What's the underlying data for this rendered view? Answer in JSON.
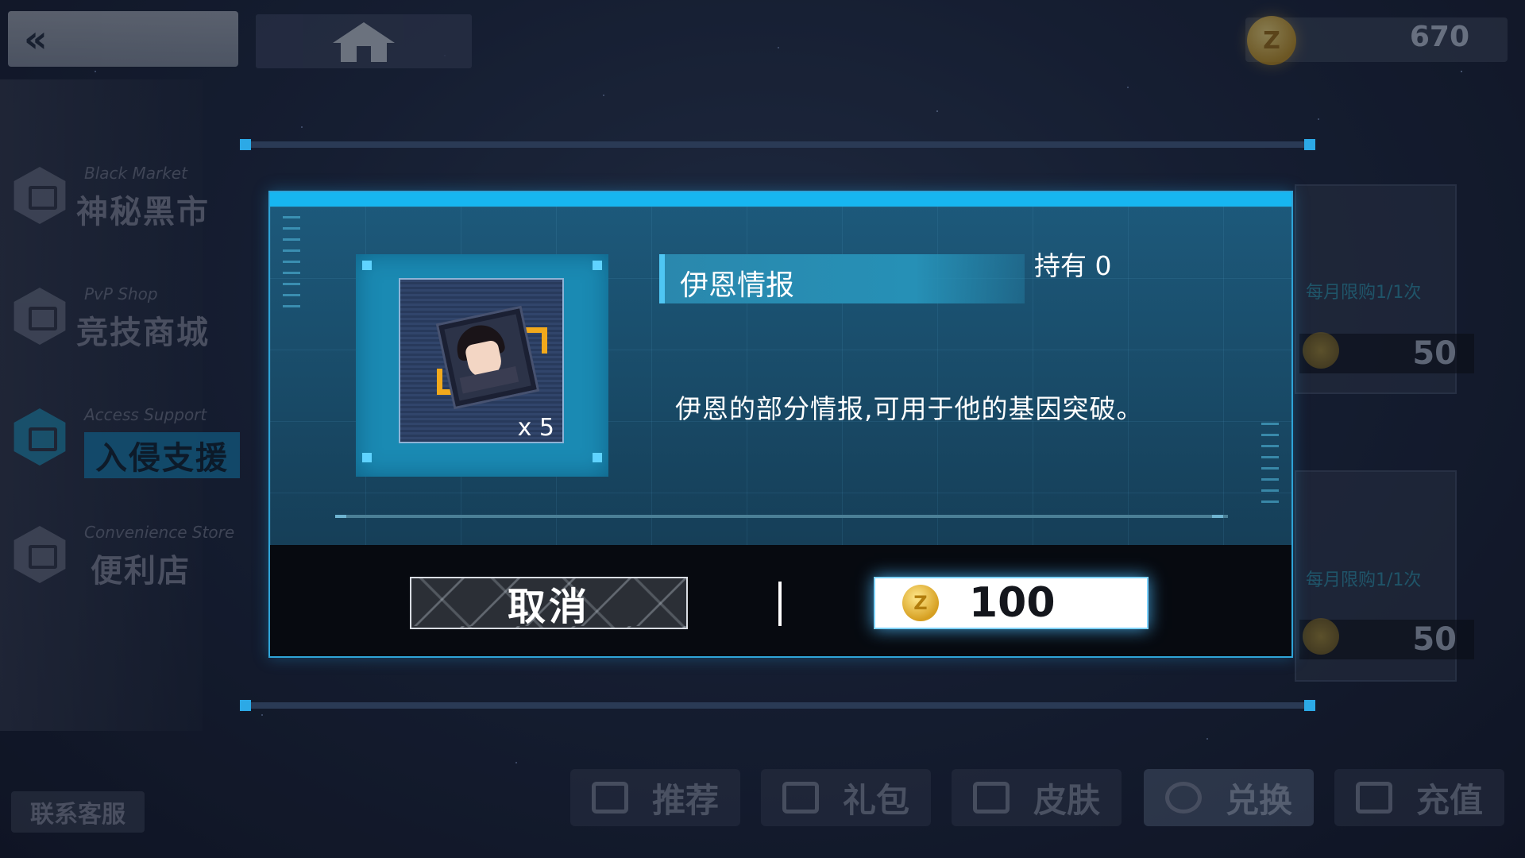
{
  "top_bar": {
    "back_icon": "double-chevron-left-icon",
    "home_icon": "home-icon",
    "currency_amount": "670"
  },
  "sidebar": {
    "items": [
      {
        "en": "Black Market",
        "zh": "神秘黑市",
        "active": false
      },
      {
        "en": "PvP Shop",
        "zh": "竞技商城",
        "active": false
      },
      {
        "en": "Access Support",
        "zh": "入侵支援",
        "active": true
      },
      {
        "en": "Convenience Store",
        "zh": "便利店",
        "active": false
      }
    ],
    "contact_label": "联系客服"
  },
  "background_cards": [
    {
      "limit": "每月限购1/1次",
      "price": "50"
    },
    {
      "limit": "每月限购1/1次",
      "price": "50"
    }
  ],
  "bottom_tabs": [
    {
      "label": "推荐",
      "icon": "heart-check-icon"
    },
    {
      "label": "礼包",
      "icon": "gift-icon"
    },
    {
      "label": "皮肤",
      "icon": "gift-icon"
    },
    {
      "label": "兑换",
      "icon": "exchange-icon",
      "active": true
    },
    {
      "label": "充值",
      "icon": "users-icon"
    }
  ],
  "dialog": {
    "item_name": "伊恩情报",
    "owned": "持有 0",
    "quantity": "x 5",
    "description": "伊恩的部分情报,可用于他的基因突破。",
    "cancel_label": "取消",
    "price": "100",
    "accent_color": "#17b6f0"
  }
}
